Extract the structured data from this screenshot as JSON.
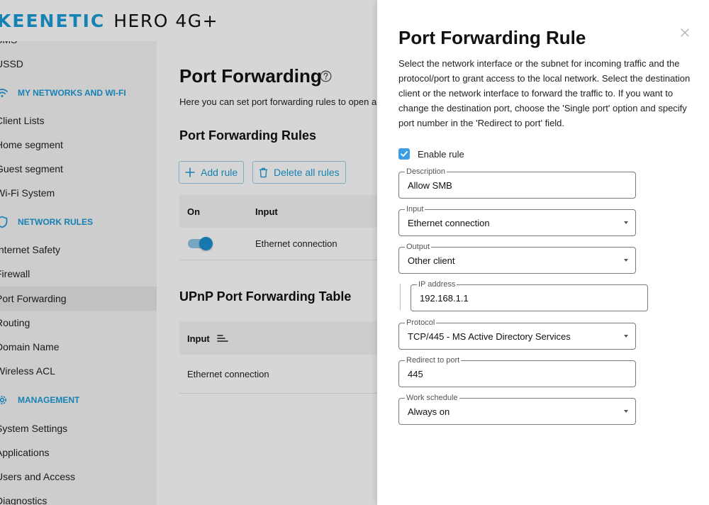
{
  "header": {
    "brand": "KEENETIC",
    "model": "HERO 4G+"
  },
  "sidebar": {
    "items": [
      {
        "type": "item",
        "label": "SMS"
      },
      {
        "type": "item",
        "label": "USSD"
      },
      {
        "type": "heading",
        "label": "MY NETWORKS AND WI-FI",
        "icon": "wifi-icon"
      },
      {
        "type": "item",
        "label": "Client Lists"
      },
      {
        "type": "item",
        "label": "Home segment"
      },
      {
        "type": "item",
        "label": "Guest segment"
      },
      {
        "type": "item",
        "label": "Wi-Fi System"
      },
      {
        "type": "heading",
        "label": "NETWORK RULES",
        "icon": "shield-icon"
      },
      {
        "type": "item",
        "label": "Internet Safety"
      },
      {
        "type": "item",
        "label": "Firewall"
      },
      {
        "type": "item",
        "label": "Port Forwarding",
        "active": true
      },
      {
        "type": "item",
        "label": "Routing"
      },
      {
        "type": "item",
        "label": "Domain Name"
      },
      {
        "type": "item",
        "label": "Wireless ACL"
      },
      {
        "type": "heading",
        "label": "MANAGEMENT",
        "icon": "gear-icon"
      },
      {
        "type": "item",
        "label": "System Settings"
      },
      {
        "type": "item",
        "label": "Applications"
      },
      {
        "type": "item",
        "label": "Users and Access"
      },
      {
        "type": "item",
        "label": "Diagnostics"
      }
    ]
  },
  "main": {
    "title": "Port Forwarding",
    "description": "Here you can set port forwarding rules to open a",
    "rules_section": {
      "title": "Port Forwarding Rules",
      "add_label": "Add rule",
      "delete_label": "Delete all rules",
      "columns": [
        "On",
        "Input"
      ],
      "rows": [
        {
          "enabled": true,
          "input": "Ethernet connection"
        }
      ]
    },
    "upnp_section": {
      "title": "UPnP Port Forwarding Table",
      "columns": [
        "Input"
      ],
      "rows": [
        {
          "input": "Ethernet connection"
        }
      ]
    }
  },
  "dialog": {
    "title": "Port Forwarding Rule",
    "description": "Select the network interface or the subnet for incoming traffic and the protocol/port to grant access to the local network. Select the destination client or the network interface to forward the traffic to. If you want to change the destination port, choose the 'Single port' option and specify port number in the 'Redirect to port' field.",
    "enable_rule": {
      "label": "Enable rule",
      "checked": true
    },
    "fields": {
      "description": {
        "label": "Description",
        "value": "Allow SMB"
      },
      "input": {
        "label": "Input",
        "value": "Ethernet connection"
      },
      "output": {
        "label": "Output",
        "value": "Other client"
      },
      "ip_address": {
        "label": "IP address",
        "value": "192.168.1.1"
      },
      "protocol": {
        "label": "Protocol",
        "value": "TCP/445 - MS Active Directory Services"
      },
      "redirect_port": {
        "label": "Redirect to port",
        "value": "445"
      },
      "schedule": {
        "label": "Work schedule",
        "value": "Always on"
      }
    }
  },
  "colors": {
    "accent": "#1b9ad6",
    "checkbox": "#3d9ee3",
    "toggle": "#1b8fd1"
  }
}
